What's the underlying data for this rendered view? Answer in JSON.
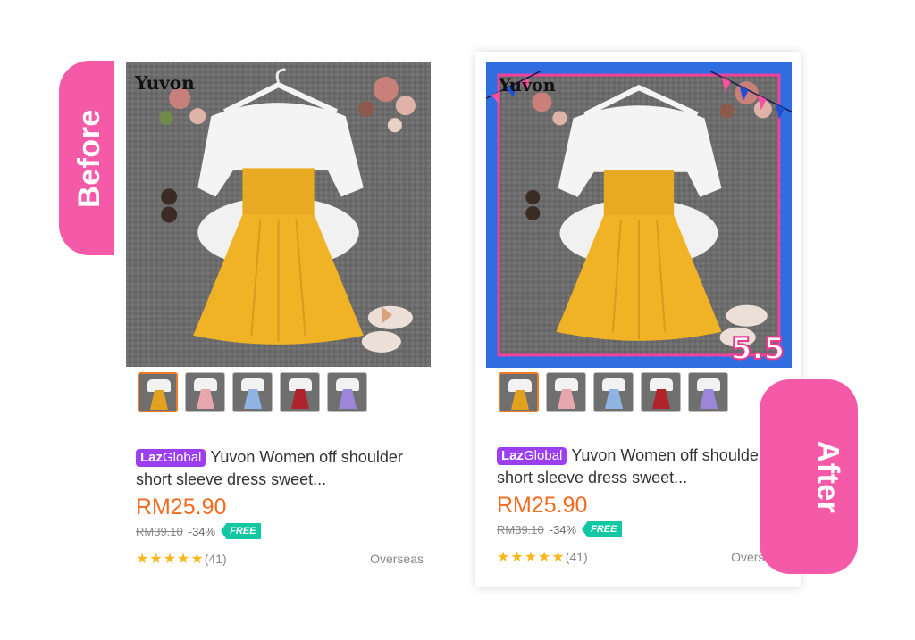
{
  "before_label": "Before",
  "after_label": "After",
  "cards": {
    "before": {
      "brand_watermark": "Yuvon",
      "badge": {
        "laz": "Laz",
        "global": "Global"
      },
      "title": "Yuvon Women off shoulder short sleeve dress sweet...",
      "price": "RM25.90",
      "original_price": "RM39.10",
      "discount": "-34%",
      "free_label": "FREE",
      "review_count": "(41)",
      "rating_stars": 5,
      "location": "Overseas"
    },
    "after": {
      "brand_watermark": "Yuvon",
      "promo_badge": "5.5",
      "badge": {
        "laz": "Laz",
        "global": "Global"
      },
      "title": "Yuvon Women off shoulder short sleeve dress sweet...",
      "price": "RM25.90",
      "original_price": "RM39.10",
      "discount": "-34%",
      "free_label": "FREE",
      "review_count": "(41)",
      "rating_stars": 5,
      "location": "Overseas"
    }
  },
  "thumbnails": [
    {
      "name": "yellow",
      "skirt_color": "#e2a11f",
      "selected": true
    },
    {
      "name": "pink",
      "skirt_color": "#e6a6ad",
      "selected": false
    },
    {
      "name": "blue",
      "skirt_color": "#8fb4e2",
      "selected": false
    },
    {
      "name": "red",
      "skirt_color": "#b0232a",
      "selected": false
    },
    {
      "name": "purple",
      "skirt_color": "#9c86d9",
      "selected": false
    }
  ],
  "colors": {
    "tab_pink": "#f45aa7",
    "price_orange": "#f26b21",
    "laz_purple": "#9b3ff1",
    "free_green": "#11c8a3",
    "star_yellow": "#f8b81c",
    "frame_blue": "#2f6de0"
  }
}
